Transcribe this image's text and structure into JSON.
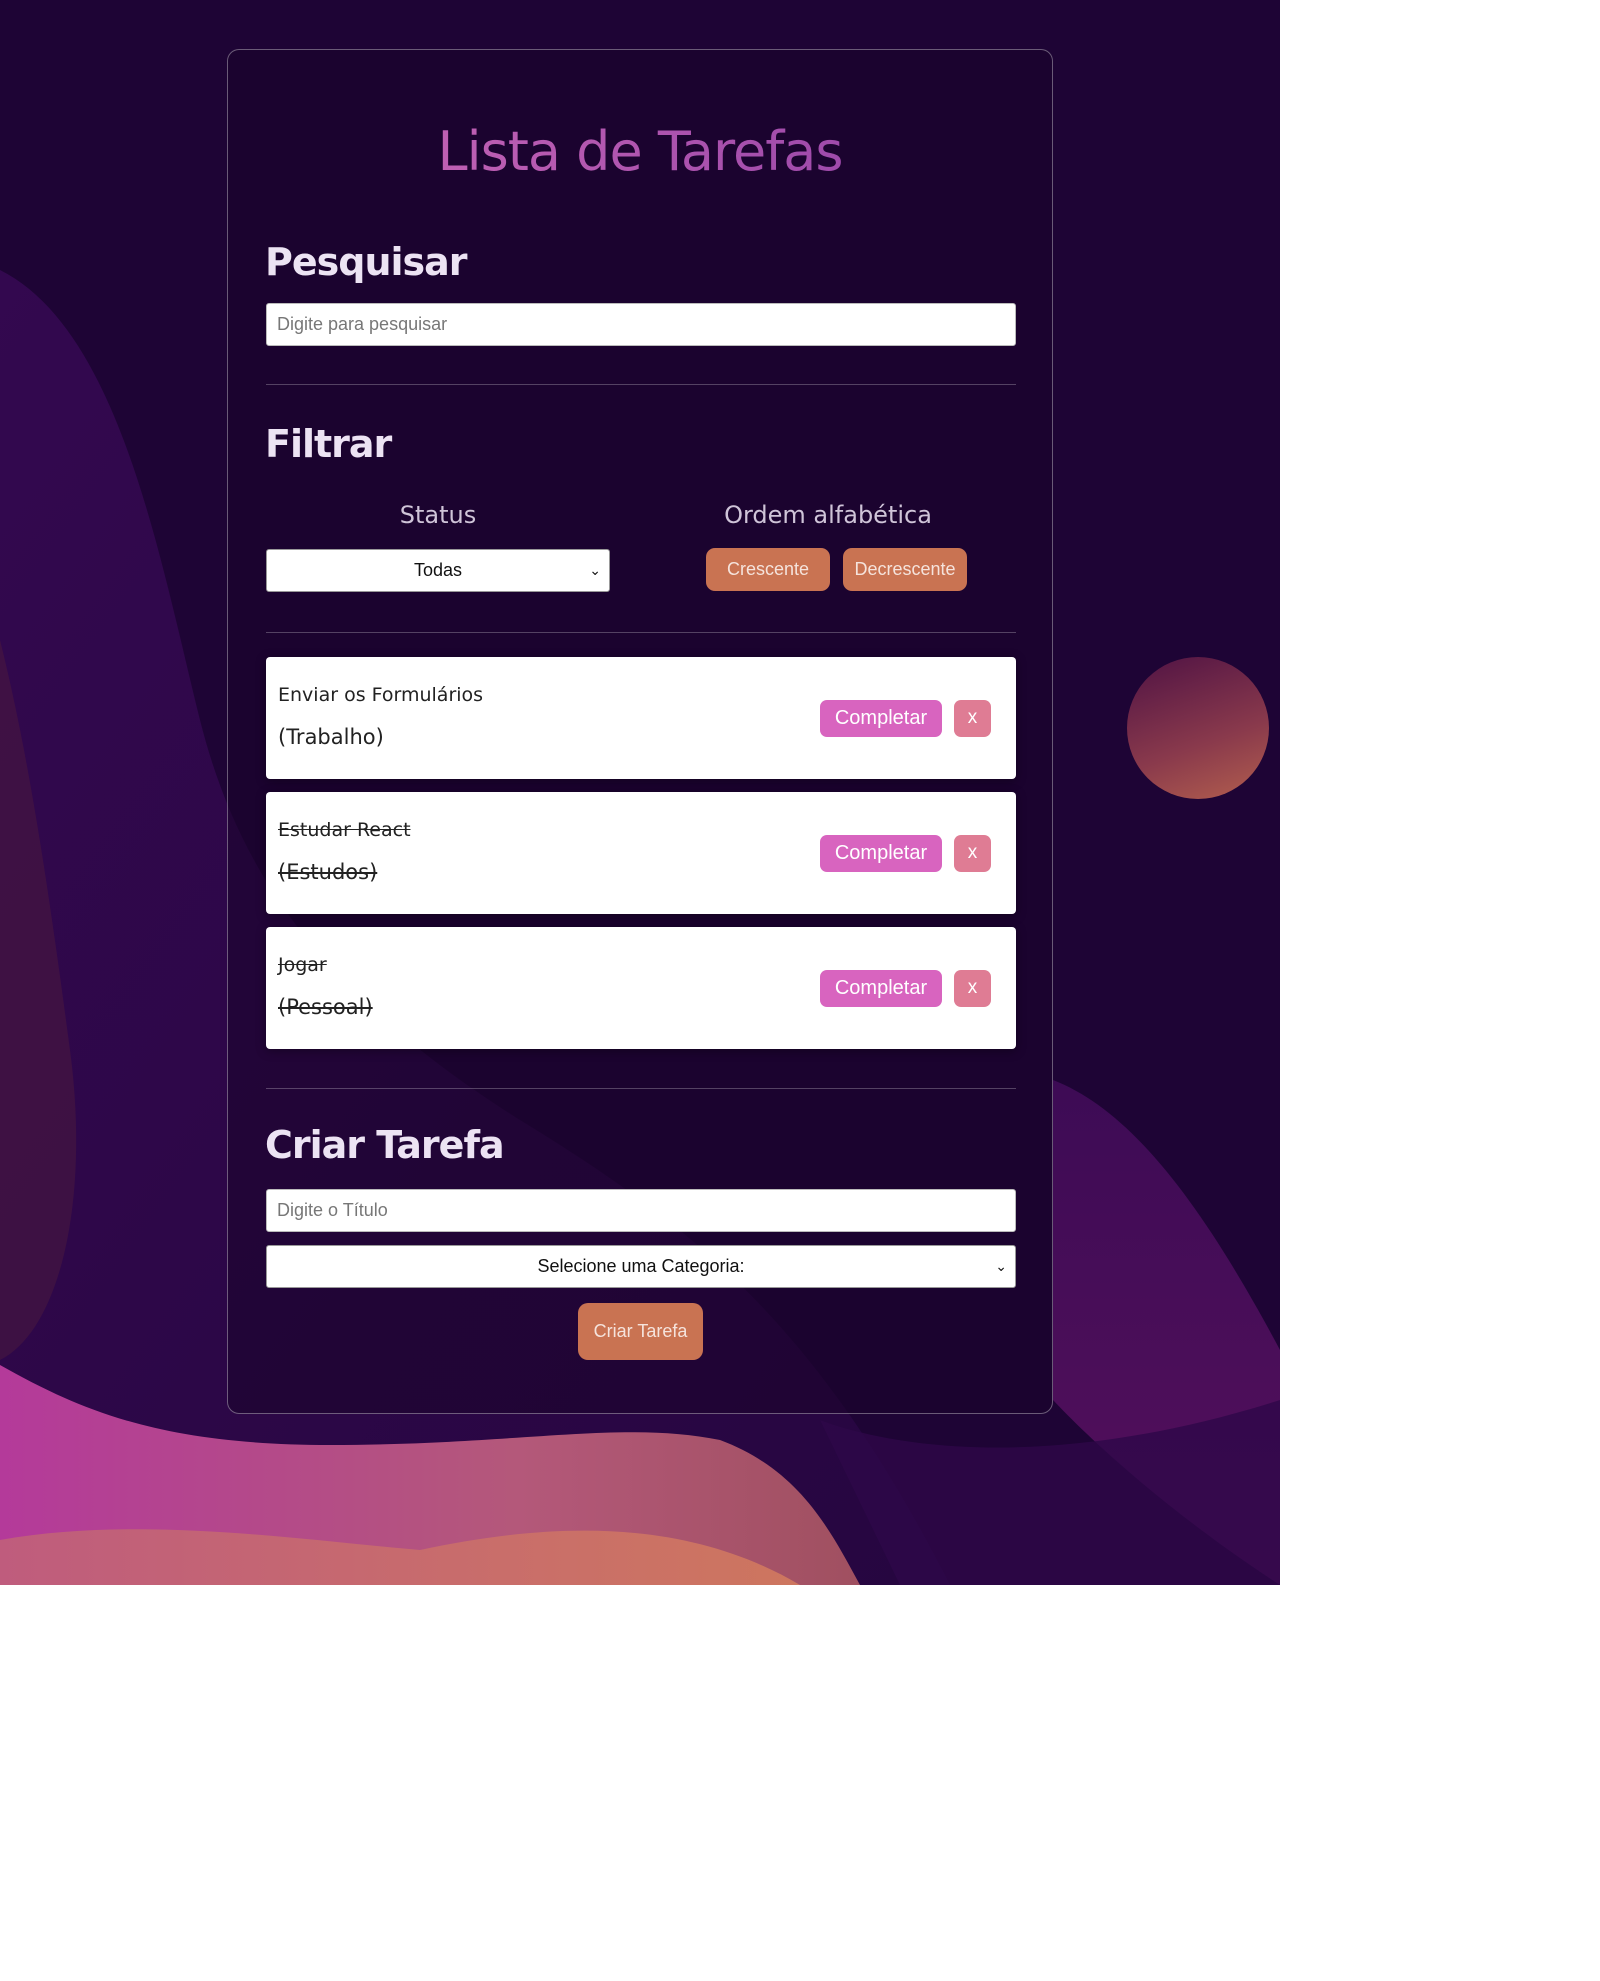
{
  "app": {
    "title": "Lista de Tarefas"
  },
  "search": {
    "heading": "Pesquisar",
    "placeholder": "Digite para pesquisar"
  },
  "filter": {
    "heading": "Filtrar",
    "status_label": "Status",
    "status_selected": "Todas",
    "order_label": "Ordem alfabética",
    "asc_label": "Crescente",
    "desc_label": "Decrescente"
  },
  "tasks": [
    {
      "title": "Enviar os Formulários",
      "category": "(Trabalho)",
      "completed": false
    },
    {
      "title": "Estudar React",
      "category": "(Estudos)",
      "completed": true
    },
    {
      "title": "Jogar",
      "category": "(Pessoal)",
      "completed": true
    }
  ],
  "task_actions": {
    "complete_label": "Completar",
    "remove_label": "x"
  },
  "create": {
    "heading": "Criar Tarefa",
    "title_placeholder": "Digite o Título",
    "category_selected": "Selecione uma Categoria:",
    "submit_label": "Criar Tarefa"
  },
  "colors": {
    "background": "#1e0435",
    "title_gradient": [
      "#d06bb8",
      "#8e3fa6"
    ],
    "orange_button": "#c97352",
    "complete_button": "#d864bf",
    "remove_button": "#df7c94"
  }
}
